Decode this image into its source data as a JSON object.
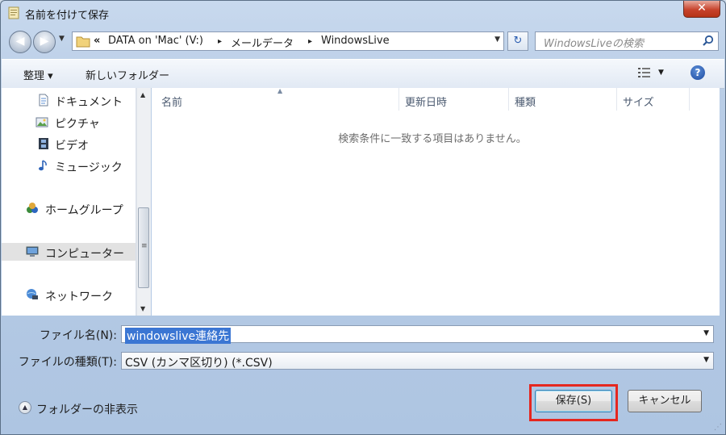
{
  "window": {
    "title": "名前を付けて保存",
    "close_label": "✕"
  },
  "navigation": {
    "back_arrow": "◀",
    "forward_arrow": "▶",
    "address_overflow": "«",
    "breadcrumbs": [
      "DATA on 'Mac' (V:)",
      "メールデータ",
      "WindowsLive"
    ],
    "crumb_separator": "▸",
    "refresh_symbol": "↻",
    "search_placeholder": "WindowsLiveの検索"
  },
  "toolbar": {
    "organize_label": "整理 ▾",
    "new_folder_label": "新しいフォルダー"
  },
  "sidebar": {
    "items": [
      {
        "label": "ドキュメント",
        "icon": "documents-icon"
      },
      {
        "label": "ピクチャ",
        "icon": "pictures-icon"
      },
      {
        "label": "ビデオ",
        "icon": "video-icon"
      },
      {
        "label": "ミュージック",
        "icon": "music-icon"
      },
      {
        "label": "ホームグループ",
        "icon": "homegroup-icon"
      },
      {
        "label": "コンピューター",
        "icon": "computer-icon",
        "selected": true
      },
      {
        "label": "ネットワーク",
        "icon": "network-icon"
      }
    ]
  },
  "file_list": {
    "columns": [
      "名前",
      "更新日時",
      "種類",
      "サイズ"
    ],
    "empty_message": "検索条件に一致する項目はありません。"
  },
  "form": {
    "filename_label": "ファイル名(N):",
    "filename_value": "windowslive連絡先",
    "filetype_label": "ファイルの種類(T):",
    "filetype_value": "CSV (カンマ区切り) (*.CSV)"
  },
  "footer": {
    "hide_folders_label": "フォルダーの非表示",
    "save_label": "保存(S)",
    "cancel_label": "キャンセル"
  },
  "colors": {
    "highlight_box": "#e5271f",
    "selection": "#3b76d3"
  }
}
